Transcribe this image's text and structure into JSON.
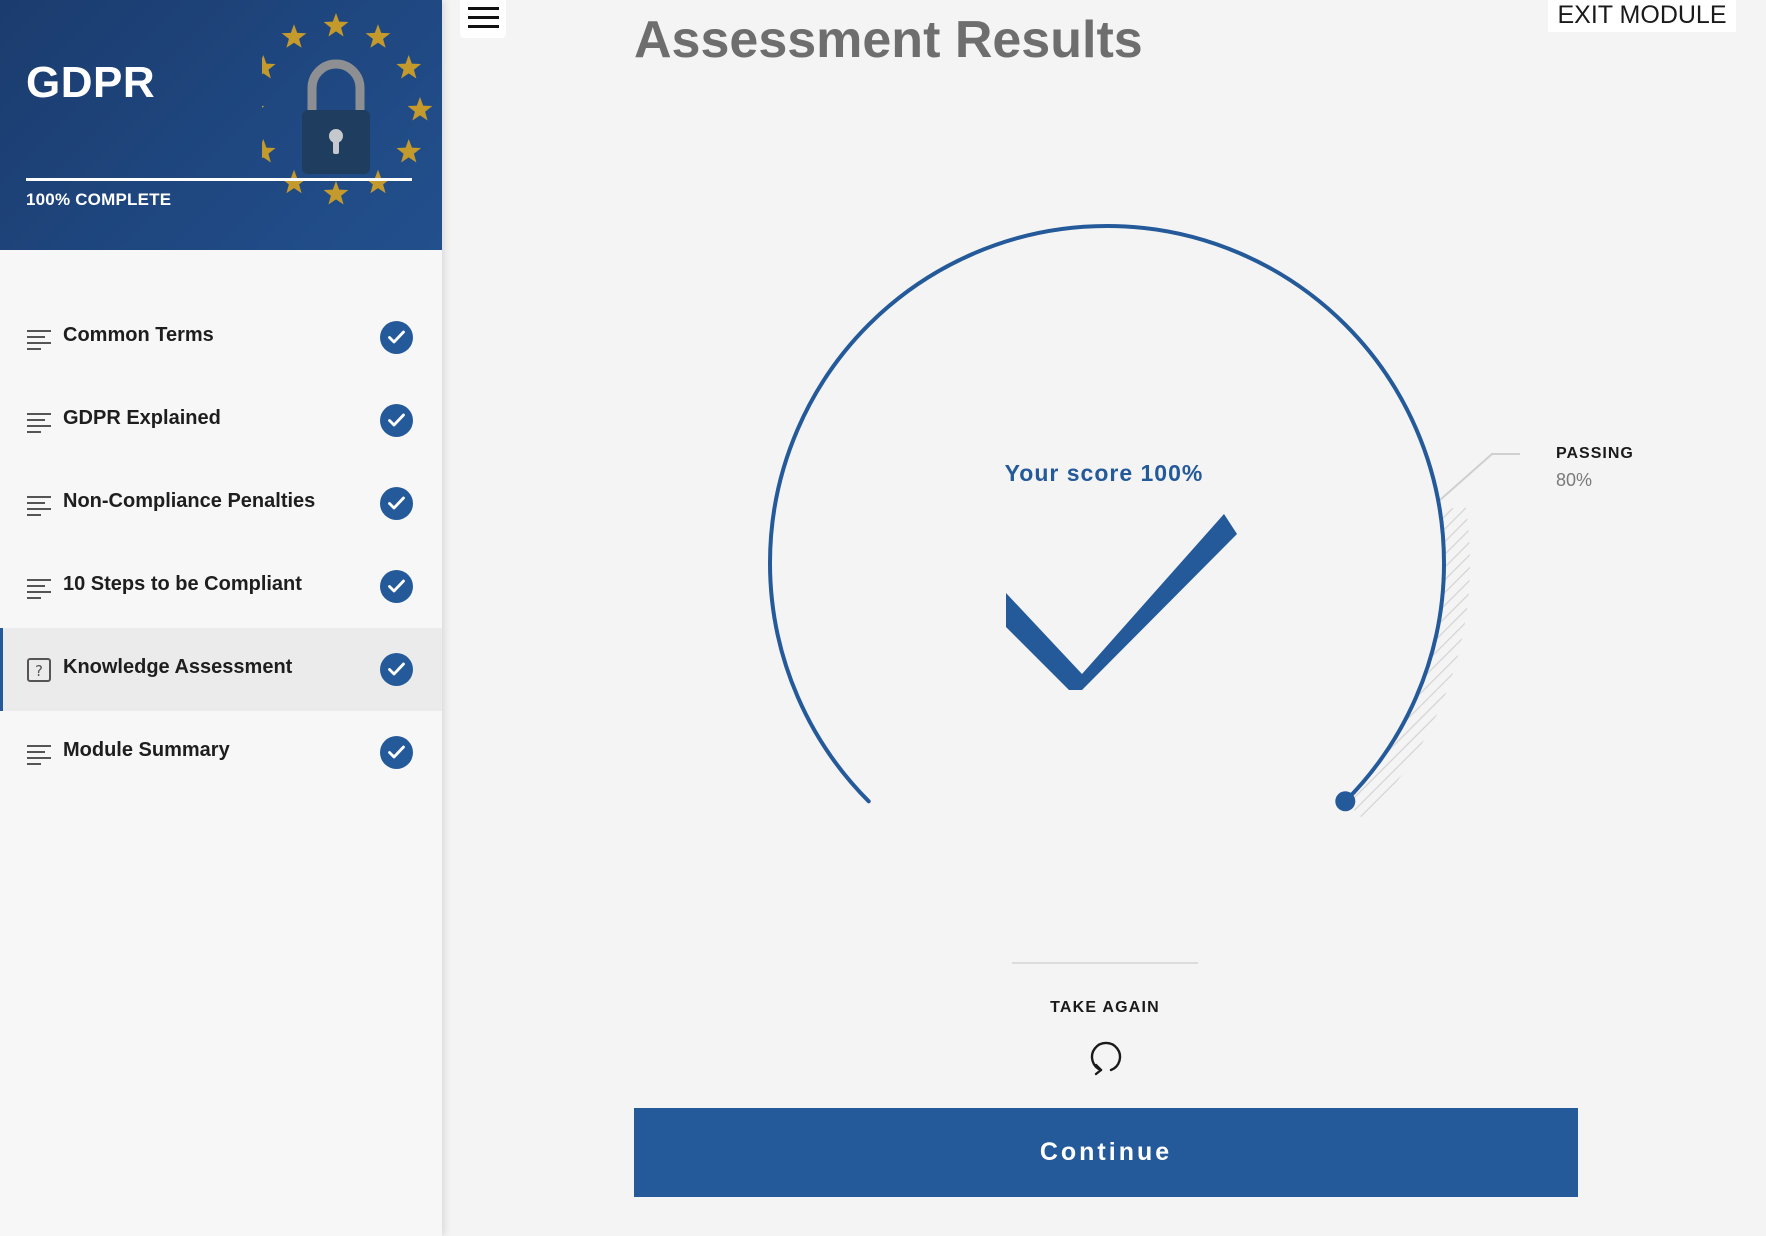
{
  "theme": {
    "accent": "#24599a",
    "hero_bg": "#1f4780",
    "star": "#c49a2c",
    "background": "#f4f4f4"
  },
  "sidebar": {
    "course_title": "GDPR",
    "hero_icons": [
      "eu-stars-icon",
      "padlock-icon"
    ],
    "progress": {
      "percent": 100,
      "label": "100% COMPLETE"
    },
    "items": [
      {
        "label": "Common Terms",
        "icon": "lines-icon",
        "completed": true,
        "active": false
      },
      {
        "label": "GDPR Explained",
        "icon": "lines-icon",
        "completed": true,
        "active": false
      },
      {
        "label": "Non-Compliance Penalties",
        "icon": "lines-icon",
        "completed": true,
        "active": false
      },
      {
        "label": "10 Steps to be Compliant",
        "icon": "lines-icon",
        "completed": true,
        "active": false
      },
      {
        "label": "Knowledge Assessment",
        "icon": "question-box-icon",
        "completed": true,
        "active": true
      },
      {
        "label": "Module Summary",
        "icon": "lines-icon",
        "completed": true,
        "active": false
      }
    ]
  },
  "header": {
    "menu_icon": "hamburger-icon",
    "title": "Assessment Results",
    "exit_label": "EXIT MODULE"
  },
  "result": {
    "score_text": "Your score 100%",
    "score_percent": 100,
    "passing_label": "PASSING",
    "passing_value": "80%",
    "passing_percent": 80,
    "result_icon": "checkmark-icon"
  },
  "actions": {
    "take_again_label": "TAKE AGAIN",
    "take_again_icon": "refresh-icon",
    "continue_label": "Continue"
  }
}
